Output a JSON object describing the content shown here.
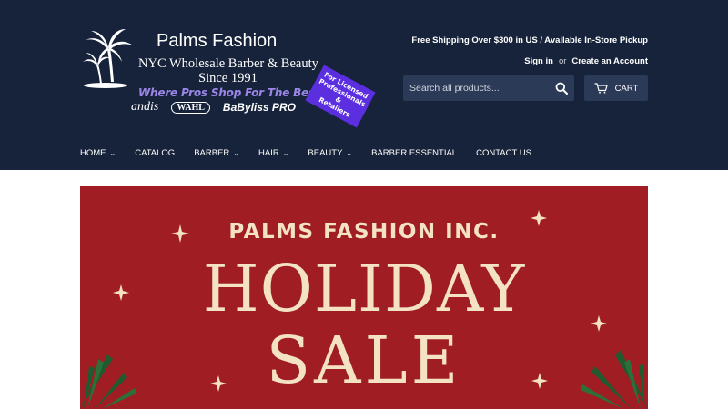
{
  "logo": {
    "brand": "Palms Fashion",
    "tagline_1": "NYC Wholesale Barber & Beauty",
    "tagline_2": "Since 1991",
    "slogan": "Where Pros Shop For The Best Value",
    "brands": [
      "andis",
      "WAHL",
      "BaByliss PRO"
    ],
    "badge": [
      "For Licensed",
      "Professionals &",
      "Retailers"
    ]
  },
  "header": {
    "shipping_notice": "Free Shipping Over $300 in US / Available In-Store Pickup",
    "sign_in": "Sign in",
    "or": "or",
    "create_account": "Create an Account",
    "search_placeholder": "Search all products...",
    "cart_label": "CART"
  },
  "nav": {
    "items": [
      {
        "label": "HOME",
        "dropdown": true
      },
      {
        "label": "CATALOG",
        "dropdown": false
      },
      {
        "label": "BARBER",
        "dropdown": true
      },
      {
        "label": "HAIR",
        "dropdown": true
      },
      {
        "label": "BEAUTY",
        "dropdown": true
      },
      {
        "label": "BARBER ESSENTIAL",
        "dropdown": false
      },
      {
        "label": "CONTACT US",
        "dropdown": false
      }
    ]
  },
  "banner": {
    "title": "PALMS FASHION INC.",
    "line_1": "HOLIDAY",
    "line_2": "SALE"
  },
  "colors": {
    "header_bg": "#17233a",
    "search_bg": "#2a3a57",
    "banner_bg": "#a01d24",
    "banner_text": "#f3e2c4",
    "slogan": "#9b86e8",
    "badge": "#5b2fe0"
  },
  "icons": {
    "search": "search-icon",
    "cart": "cart-icon",
    "chevron": "chevron-down-icon",
    "palm": "palm-tree-icon",
    "sparkle": "sparkle-icon"
  }
}
